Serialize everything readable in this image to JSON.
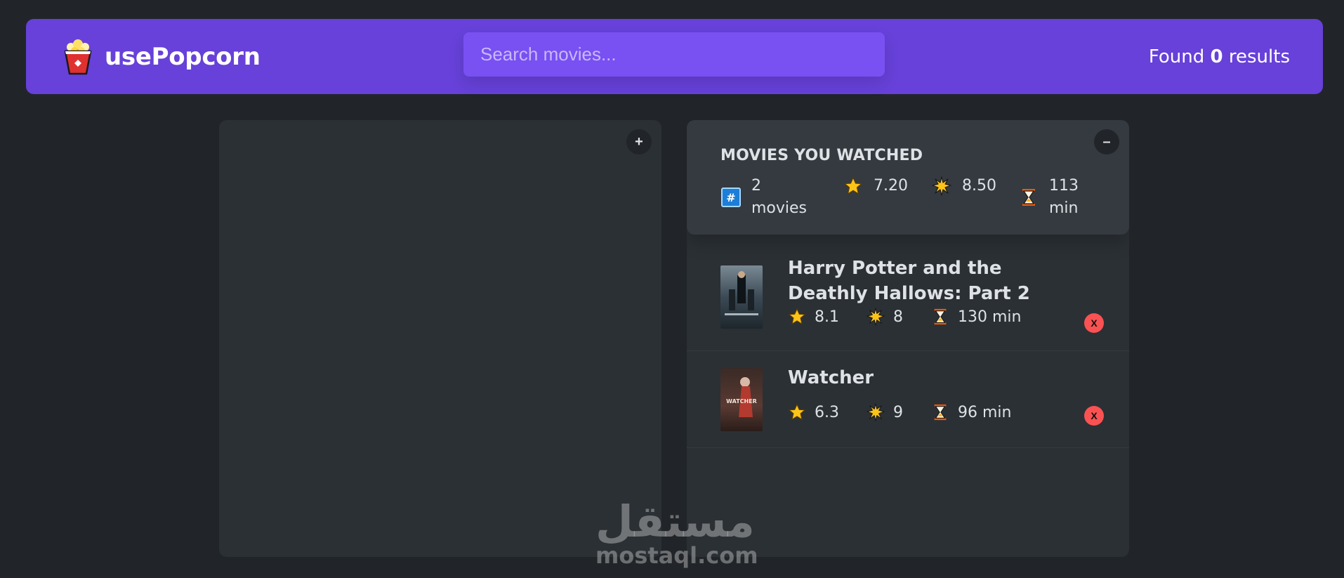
{
  "nav": {
    "logo_text": "usePopcorn",
    "logo_icon": "popcorn-icon",
    "search_placeholder": "Search movies...",
    "search_value": "",
    "results_prefix": "Found ",
    "results_count": "0",
    "results_suffix": " results"
  },
  "left_box": {
    "toggle_label": "+"
  },
  "watched_box": {
    "toggle_label": "–",
    "summary": {
      "title": "MOVIES YOU WATCHED",
      "count": "2 movies",
      "avg_imdb_rating": "7.20",
      "avg_user_rating": "8.50",
      "avg_runtime": "113 min"
    },
    "movies": [
      {
        "title": "Harry Potter and the Deathly Hallows: Part 2",
        "imdb_rating": "8.1",
        "user_rating": "8",
        "runtime": "130 min",
        "delete_label": "X"
      },
      {
        "title": "Watcher",
        "imdb_rating": "6.3",
        "user_rating": "9",
        "runtime": "96 min",
        "delete_label": "X",
        "poster_text": "WATCHER"
      }
    ]
  },
  "watermark": {
    "arabic": "مستقل",
    "latin": "mostaql.com"
  },
  "colors": {
    "background": "#212529",
    "nav": "#6741d9",
    "search": "#7950f2",
    "box": "#2b3035",
    "summary": "#343a40",
    "delete": "#fa5252"
  }
}
